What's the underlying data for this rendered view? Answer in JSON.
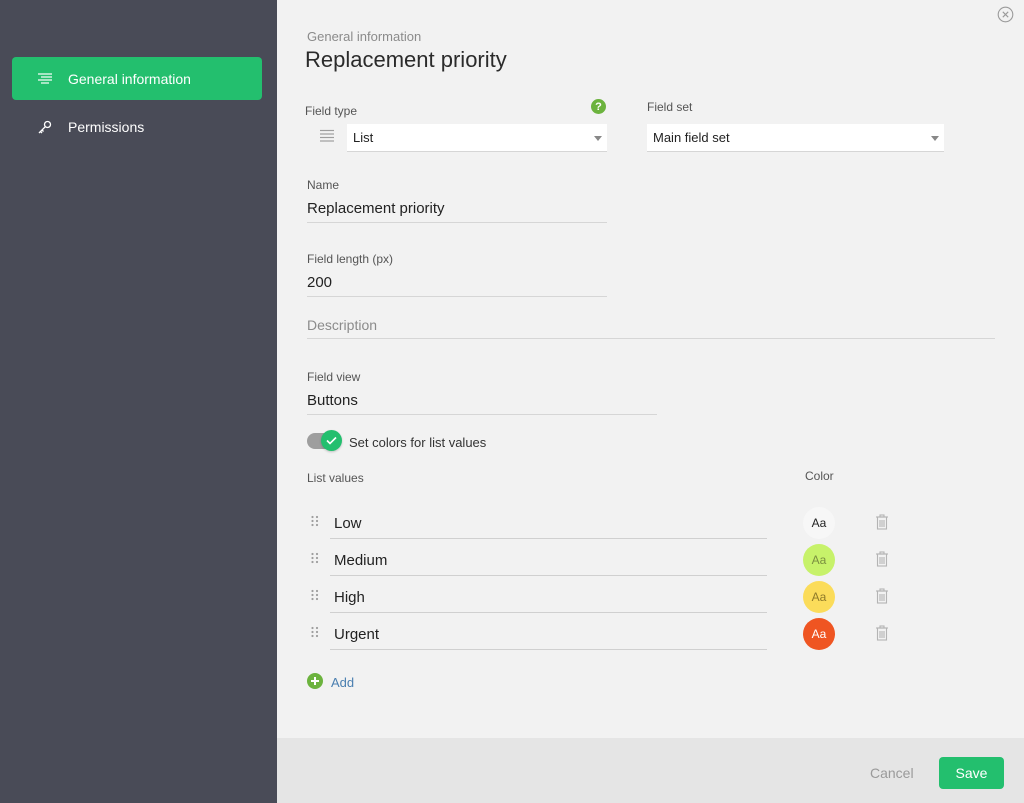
{
  "sidebar": {
    "items": [
      {
        "label": "General information",
        "icon": "list-lines-icon",
        "active": true
      },
      {
        "label": "Permissions",
        "icon": "key-icon",
        "active": false
      }
    ]
  },
  "header": {
    "breadcrumb": "General information",
    "title": "Replacement priority"
  },
  "form": {
    "field_type": {
      "label": "Field type",
      "value": "List",
      "help": "?"
    },
    "field_set": {
      "label": "Field set",
      "value": "Main field set"
    },
    "name": {
      "label": "Name",
      "value": "Replacement priority"
    },
    "field_length": {
      "label": "Field length (px)",
      "value": "200"
    },
    "description": {
      "placeholder": "Description"
    },
    "field_view": {
      "label": "Field view",
      "value": "Buttons"
    },
    "set_colors": {
      "label": "Set colors for list values",
      "checked": true
    }
  },
  "list": {
    "header_values": "List values",
    "header_color": "Color",
    "items": [
      {
        "value": "Low",
        "swatch_text": "Aa",
        "color": "#f7f7f7",
        "text_color": "#222222"
      },
      {
        "value": "Medium",
        "swatch_text": "Aa",
        "color": "#c7f26a",
        "text_color": "#7a8f40"
      },
      {
        "value": "High",
        "swatch_text": "Aa",
        "color": "#fbdc5a",
        "text_color": "#8f7a2a"
      },
      {
        "value": "Urgent",
        "swatch_text": "Aa",
        "color": "#ef5522",
        "text_color": "#ffffff"
      }
    ],
    "add_label": "Add"
  },
  "footer": {
    "cancel_label": "Cancel",
    "save_label": "Save"
  },
  "colors": {
    "accent": "#23bf6e",
    "sidebar_bg": "#494b57",
    "link": "#4a7fb0"
  }
}
